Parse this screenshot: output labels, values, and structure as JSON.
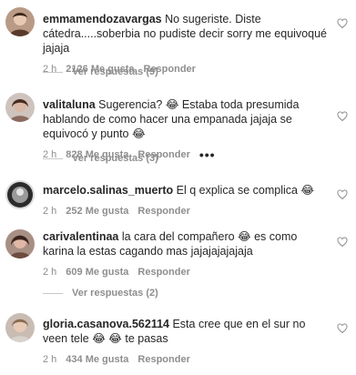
{
  "comments": [
    {
      "username": "emmamendozavargas",
      "text": "No sugeriste. Diste cátedra.....soberbia no pudiste decir sorry me equivoqué jajaja",
      "time": "2 h",
      "likes": "2126 Me gusta",
      "reply": "Responder",
      "view_replies": "Ver respuestas (9)"
    },
    {
      "username": "valitaluna",
      "text": "Sugerencia? 😂 Estaba toda presumida hablando de como hacer una empanada jajaja se equivocó y punto 😂",
      "time": "2 h",
      "likes": "828 Me gusta",
      "reply": "Responder",
      "more": "•••",
      "view_replies": "Ver respuestas (3)"
    },
    {
      "username": "marcelo.salinas_muerto",
      "text": "El q explica se complica 😂",
      "time": "2 h",
      "likes": "252 Me gusta",
      "reply": "Responder"
    },
    {
      "username": "carivalentinaa",
      "text": "la cara del compañero 😂 es como karina la estas cagando mas jajajajajajaja",
      "time": "2 h",
      "likes": "609 Me gusta",
      "reply": "Responder",
      "view_replies": "Ver respuestas (2)"
    },
    {
      "username": "gloria.casanova.562114",
      "text": "Esta cree que en el sur no veen tele 😂 😂 te pasas",
      "time": "2 h",
      "likes": "434 Me gusta",
      "reply": "Responder"
    }
  ],
  "icons": {
    "like": "heart-outline-icon"
  },
  "colors": {
    "text": "#262626",
    "secondary": "#8e8e8e"
  }
}
